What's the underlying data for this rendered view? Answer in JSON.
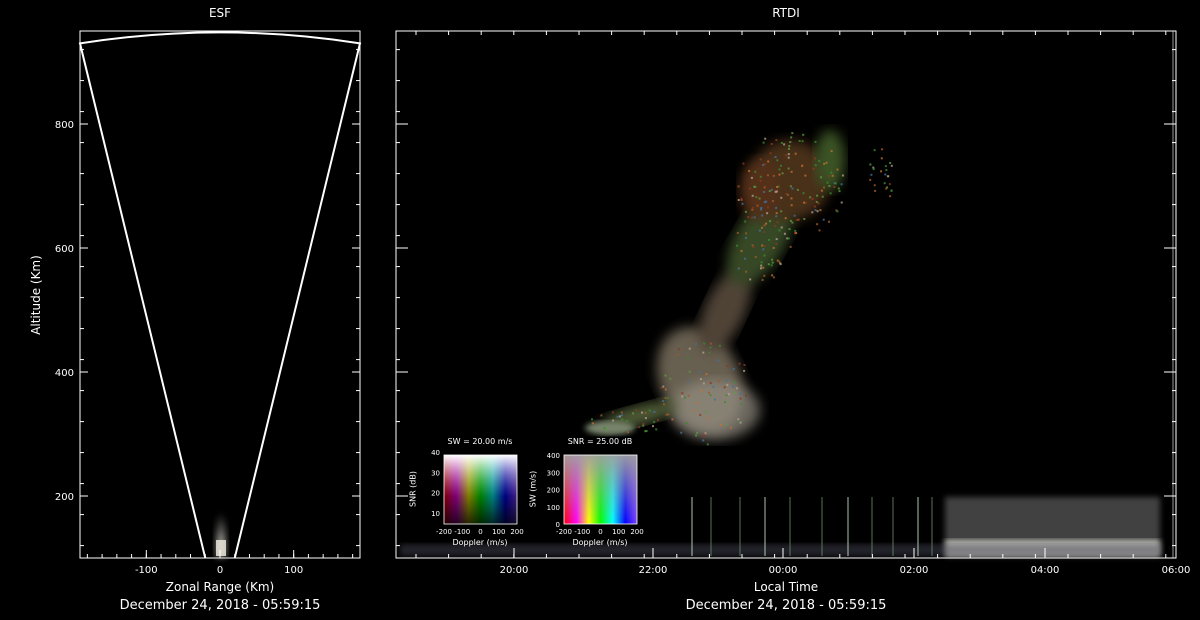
{
  "chart_data": [
    {
      "type": "scatter",
      "title": "ESF",
      "xlabel": "Zonal Range (Km)",
      "ylabel": "Altitude (Km)",
      "footer": "December 24, 2018 - 05:59:15",
      "xlim": [
        -190,
        190
      ],
      "ylim": [
        100,
        950
      ],
      "x_ticks": [
        -100,
        0,
        100
      ],
      "y_ticks": [
        200,
        400,
        600,
        800
      ],
      "grid": false,
      "fan_outline": {
        "left_edge": [
          [
            -20,
            100
          ],
          [
            -190,
            930
          ]
        ],
        "right_edge": [
          [
            20,
            100
          ],
          [
            190,
            930
          ]
        ]
      },
      "echo": {
        "x_range": [
          -10,
          8
        ],
        "y_range": [
          100,
          195
        ]
      }
    },
    {
      "type": "heatmap",
      "title": "RTDI",
      "xlabel": "Local Time",
      "footer": "December 24, 2018 - 05:59:15",
      "x_ticks": [
        "20:00",
        "22:00",
        "00:00",
        "02:00",
        "04:00",
        "06:00"
      ],
      "grid": false
    }
  ],
  "legends": {
    "snr_doppler": {
      "title": "SW = 20.00 m/s",
      "xlabel": "Doppler (m/s)",
      "ylabel": "SNR (dB)",
      "x_ticks": [
        "-200",
        "-100",
        "0",
        "100",
        "200"
      ],
      "y_ticks": [
        "10",
        "20",
        "30",
        "40"
      ]
    },
    "sw_doppler": {
      "title": "SNR = 25.00 dB",
      "xlabel": "Doppler (m/s)",
      "ylabel": "SW (m/s)",
      "x_ticks": [
        "-200",
        "-100",
        "0",
        "100",
        "200"
      ],
      "y_ticks": [
        "0",
        "100",
        "200",
        "300",
        "400"
      ]
    }
  },
  "colors": {
    "background": "#000000",
    "axes": "#ffffff"
  }
}
